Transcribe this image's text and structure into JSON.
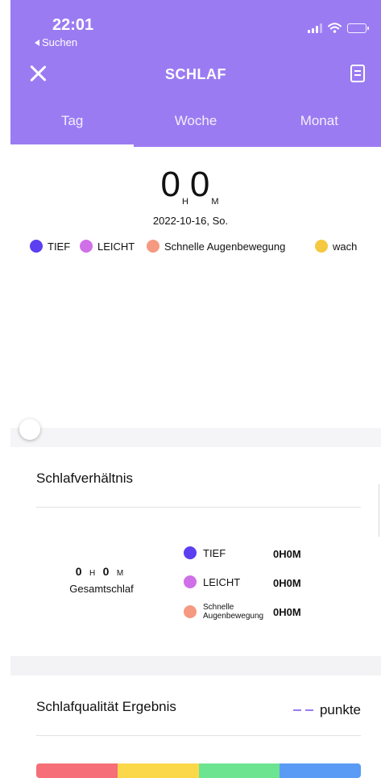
{
  "status_bar": {
    "time": "22:01",
    "back_label": "Suchen"
  },
  "header": {
    "title": "SCHLAF"
  },
  "tabs": [
    {
      "label": "Tag",
      "active": true
    },
    {
      "label": "Woche",
      "active": false
    },
    {
      "label": "Monat",
      "active": false
    }
  ],
  "summary": {
    "hours": "0",
    "hours_unit": "H",
    "minutes": "0",
    "minutes_unit": "M",
    "date": "2022-10-16, So."
  },
  "legend": [
    {
      "label": "TIEF",
      "color": "#5b3ff0"
    },
    {
      "label": "LEICHT",
      "color": "#d070e8"
    },
    {
      "label": "Schnelle Augenbewegung",
      "color": "#f59a80"
    },
    {
      "label": "wach",
      "color": "#f5c842"
    }
  ],
  "timeline": {
    "position": 0
  },
  "ratio_section": {
    "title": "Schlafverhältnis",
    "total": {
      "hours": "0",
      "hours_unit": "H",
      "minutes": "0",
      "minutes_unit": "M",
      "label": "Gesamtschlaf"
    },
    "rows": [
      {
        "label": "TIEF",
        "value": "0H0M",
        "color": "#5b3ff0"
      },
      {
        "label": "LEICHT",
        "value": "0H0M",
        "color": "#d070e8"
      },
      {
        "label_line1": "Schnelle",
        "label_line2": "Augenbewegung",
        "value": "0H0M",
        "color": "#f59a80"
      }
    ]
  },
  "quality_section": {
    "title": "Schlafqualität Ergebnis",
    "points_label": "punkte",
    "bar_colors": [
      "#f56e78",
      "#fbd84a",
      "#6de48f",
      "#5a9cf5"
    ]
  },
  "colors": {
    "header_bg": "#9b7bf2",
    "accent": "#9b7bf2"
  }
}
